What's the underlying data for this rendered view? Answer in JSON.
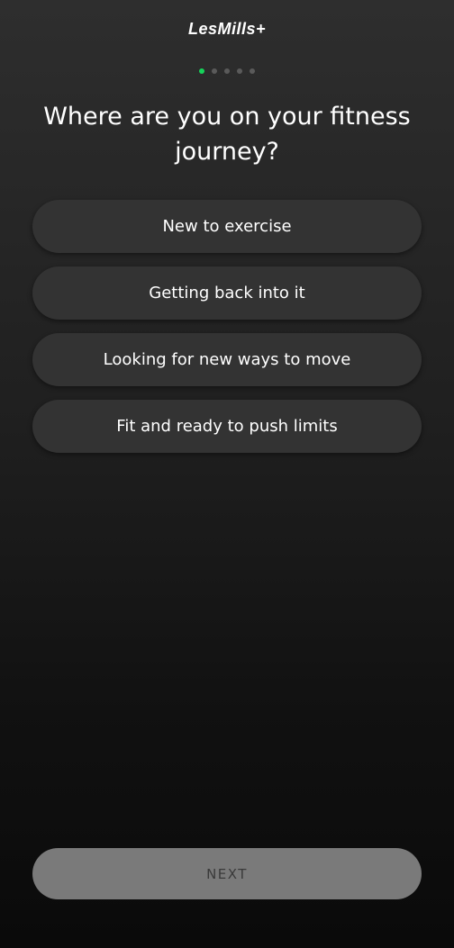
{
  "header": {
    "logo_text": "LesMills+"
  },
  "progress": {
    "total_steps": 5,
    "current_step": 1,
    "active_color": "#16d35a",
    "inactive_color": "#5a5a5a"
  },
  "question": {
    "title": "Where are you on your fitness journey?"
  },
  "options": [
    {
      "label": "New to exercise"
    },
    {
      "label": "Getting back into it"
    },
    {
      "label": "Looking for new ways to move"
    },
    {
      "label": "Fit and ready to push limits"
    }
  ],
  "footer": {
    "next_label": "NEXT"
  }
}
